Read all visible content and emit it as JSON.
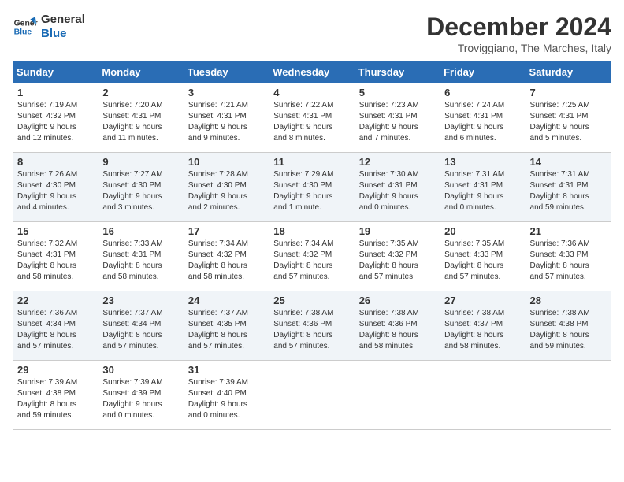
{
  "header": {
    "logo_line1": "General",
    "logo_line2": "Blue",
    "month_title": "December 2024",
    "subtitle": "Troviggiano, The Marches, Italy"
  },
  "days_of_week": [
    "Sunday",
    "Monday",
    "Tuesday",
    "Wednesday",
    "Thursday",
    "Friday",
    "Saturday"
  ],
  "weeks": [
    [
      {
        "day": "1",
        "info": "Sunrise: 7:19 AM\nSunset: 4:32 PM\nDaylight: 9 hours\nand 12 minutes."
      },
      {
        "day": "2",
        "info": "Sunrise: 7:20 AM\nSunset: 4:31 PM\nDaylight: 9 hours\nand 11 minutes."
      },
      {
        "day": "3",
        "info": "Sunrise: 7:21 AM\nSunset: 4:31 PM\nDaylight: 9 hours\nand 9 minutes."
      },
      {
        "day": "4",
        "info": "Sunrise: 7:22 AM\nSunset: 4:31 PM\nDaylight: 9 hours\nand 8 minutes."
      },
      {
        "day": "5",
        "info": "Sunrise: 7:23 AM\nSunset: 4:31 PM\nDaylight: 9 hours\nand 7 minutes."
      },
      {
        "day": "6",
        "info": "Sunrise: 7:24 AM\nSunset: 4:31 PM\nDaylight: 9 hours\nand 6 minutes."
      },
      {
        "day": "7",
        "info": "Sunrise: 7:25 AM\nSunset: 4:31 PM\nDaylight: 9 hours\nand 5 minutes."
      }
    ],
    [
      {
        "day": "8",
        "info": "Sunrise: 7:26 AM\nSunset: 4:30 PM\nDaylight: 9 hours\nand 4 minutes."
      },
      {
        "day": "9",
        "info": "Sunrise: 7:27 AM\nSunset: 4:30 PM\nDaylight: 9 hours\nand 3 minutes."
      },
      {
        "day": "10",
        "info": "Sunrise: 7:28 AM\nSunset: 4:30 PM\nDaylight: 9 hours\nand 2 minutes."
      },
      {
        "day": "11",
        "info": "Sunrise: 7:29 AM\nSunset: 4:30 PM\nDaylight: 9 hours\nand 1 minute."
      },
      {
        "day": "12",
        "info": "Sunrise: 7:30 AM\nSunset: 4:31 PM\nDaylight: 9 hours\nand 0 minutes."
      },
      {
        "day": "13",
        "info": "Sunrise: 7:31 AM\nSunset: 4:31 PM\nDaylight: 9 hours\nand 0 minutes."
      },
      {
        "day": "14",
        "info": "Sunrise: 7:31 AM\nSunset: 4:31 PM\nDaylight: 8 hours\nand 59 minutes."
      }
    ],
    [
      {
        "day": "15",
        "info": "Sunrise: 7:32 AM\nSunset: 4:31 PM\nDaylight: 8 hours\nand 58 minutes."
      },
      {
        "day": "16",
        "info": "Sunrise: 7:33 AM\nSunset: 4:31 PM\nDaylight: 8 hours\nand 58 minutes."
      },
      {
        "day": "17",
        "info": "Sunrise: 7:34 AM\nSunset: 4:32 PM\nDaylight: 8 hours\nand 58 minutes."
      },
      {
        "day": "18",
        "info": "Sunrise: 7:34 AM\nSunset: 4:32 PM\nDaylight: 8 hours\nand 57 minutes."
      },
      {
        "day": "19",
        "info": "Sunrise: 7:35 AM\nSunset: 4:32 PM\nDaylight: 8 hours\nand 57 minutes."
      },
      {
        "day": "20",
        "info": "Sunrise: 7:35 AM\nSunset: 4:33 PM\nDaylight: 8 hours\nand 57 minutes."
      },
      {
        "day": "21",
        "info": "Sunrise: 7:36 AM\nSunset: 4:33 PM\nDaylight: 8 hours\nand 57 minutes."
      }
    ],
    [
      {
        "day": "22",
        "info": "Sunrise: 7:36 AM\nSunset: 4:34 PM\nDaylight: 8 hours\nand 57 minutes."
      },
      {
        "day": "23",
        "info": "Sunrise: 7:37 AM\nSunset: 4:34 PM\nDaylight: 8 hours\nand 57 minutes."
      },
      {
        "day": "24",
        "info": "Sunrise: 7:37 AM\nSunset: 4:35 PM\nDaylight: 8 hours\nand 57 minutes."
      },
      {
        "day": "25",
        "info": "Sunrise: 7:38 AM\nSunset: 4:36 PM\nDaylight: 8 hours\nand 57 minutes."
      },
      {
        "day": "26",
        "info": "Sunrise: 7:38 AM\nSunset: 4:36 PM\nDaylight: 8 hours\nand 58 minutes."
      },
      {
        "day": "27",
        "info": "Sunrise: 7:38 AM\nSunset: 4:37 PM\nDaylight: 8 hours\nand 58 minutes."
      },
      {
        "day": "28",
        "info": "Sunrise: 7:38 AM\nSunset: 4:38 PM\nDaylight: 8 hours\nand 59 minutes."
      }
    ],
    [
      {
        "day": "29",
        "info": "Sunrise: 7:39 AM\nSunset: 4:38 PM\nDaylight: 8 hours\nand 59 minutes."
      },
      {
        "day": "30",
        "info": "Sunrise: 7:39 AM\nSunset: 4:39 PM\nDaylight: 9 hours\nand 0 minutes."
      },
      {
        "day": "31",
        "info": "Sunrise: 7:39 AM\nSunset: 4:40 PM\nDaylight: 9 hours\nand 0 minutes."
      },
      {
        "day": "",
        "info": ""
      },
      {
        "day": "",
        "info": ""
      },
      {
        "day": "",
        "info": ""
      },
      {
        "day": "",
        "info": ""
      }
    ]
  ]
}
